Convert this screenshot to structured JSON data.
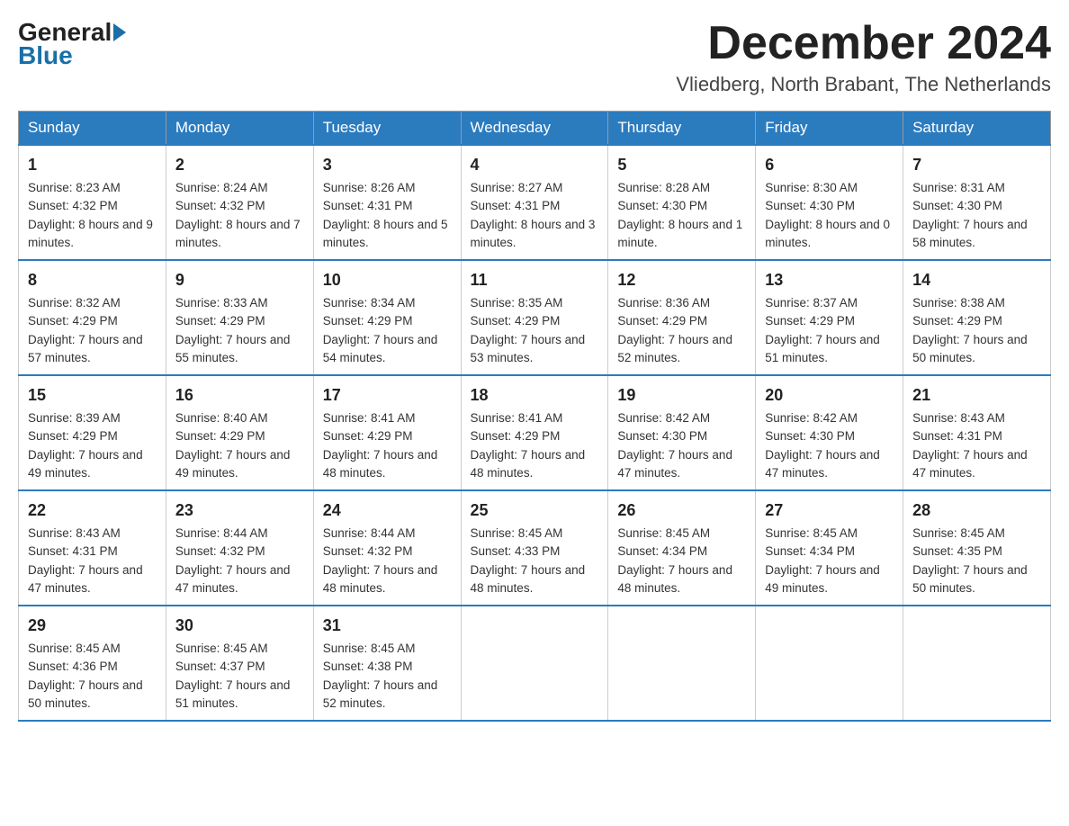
{
  "header": {
    "logo": {
      "text1": "General",
      "text2": "Blue"
    },
    "title": "December 2024",
    "location": "Vliedberg, North Brabant, The Netherlands"
  },
  "days_of_week": [
    "Sunday",
    "Monday",
    "Tuesday",
    "Wednesday",
    "Thursday",
    "Friday",
    "Saturday"
  ],
  "weeks": [
    [
      {
        "day": "1",
        "sunrise": "8:23 AM",
        "sunset": "4:32 PM",
        "daylight": "8 hours and 9 minutes."
      },
      {
        "day": "2",
        "sunrise": "8:24 AM",
        "sunset": "4:32 PM",
        "daylight": "8 hours and 7 minutes."
      },
      {
        "day": "3",
        "sunrise": "8:26 AM",
        "sunset": "4:31 PM",
        "daylight": "8 hours and 5 minutes."
      },
      {
        "day": "4",
        "sunrise": "8:27 AM",
        "sunset": "4:31 PM",
        "daylight": "8 hours and 3 minutes."
      },
      {
        "day": "5",
        "sunrise": "8:28 AM",
        "sunset": "4:30 PM",
        "daylight": "8 hours and 1 minute."
      },
      {
        "day": "6",
        "sunrise": "8:30 AM",
        "sunset": "4:30 PM",
        "daylight": "8 hours and 0 minutes."
      },
      {
        "day": "7",
        "sunrise": "8:31 AM",
        "sunset": "4:30 PM",
        "daylight": "7 hours and 58 minutes."
      }
    ],
    [
      {
        "day": "8",
        "sunrise": "8:32 AM",
        "sunset": "4:29 PM",
        "daylight": "7 hours and 57 minutes."
      },
      {
        "day": "9",
        "sunrise": "8:33 AM",
        "sunset": "4:29 PM",
        "daylight": "7 hours and 55 minutes."
      },
      {
        "day": "10",
        "sunrise": "8:34 AM",
        "sunset": "4:29 PM",
        "daylight": "7 hours and 54 minutes."
      },
      {
        "day": "11",
        "sunrise": "8:35 AM",
        "sunset": "4:29 PM",
        "daylight": "7 hours and 53 minutes."
      },
      {
        "day": "12",
        "sunrise": "8:36 AM",
        "sunset": "4:29 PM",
        "daylight": "7 hours and 52 minutes."
      },
      {
        "day": "13",
        "sunrise": "8:37 AM",
        "sunset": "4:29 PM",
        "daylight": "7 hours and 51 minutes."
      },
      {
        "day": "14",
        "sunrise": "8:38 AM",
        "sunset": "4:29 PM",
        "daylight": "7 hours and 50 minutes."
      }
    ],
    [
      {
        "day": "15",
        "sunrise": "8:39 AM",
        "sunset": "4:29 PM",
        "daylight": "7 hours and 49 minutes."
      },
      {
        "day": "16",
        "sunrise": "8:40 AM",
        "sunset": "4:29 PM",
        "daylight": "7 hours and 49 minutes."
      },
      {
        "day": "17",
        "sunrise": "8:41 AM",
        "sunset": "4:29 PM",
        "daylight": "7 hours and 48 minutes."
      },
      {
        "day": "18",
        "sunrise": "8:41 AM",
        "sunset": "4:29 PM",
        "daylight": "7 hours and 48 minutes."
      },
      {
        "day": "19",
        "sunrise": "8:42 AM",
        "sunset": "4:30 PM",
        "daylight": "7 hours and 47 minutes."
      },
      {
        "day": "20",
        "sunrise": "8:42 AM",
        "sunset": "4:30 PM",
        "daylight": "7 hours and 47 minutes."
      },
      {
        "day": "21",
        "sunrise": "8:43 AM",
        "sunset": "4:31 PM",
        "daylight": "7 hours and 47 minutes."
      }
    ],
    [
      {
        "day": "22",
        "sunrise": "8:43 AM",
        "sunset": "4:31 PM",
        "daylight": "7 hours and 47 minutes."
      },
      {
        "day": "23",
        "sunrise": "8:44 AM",
        "sunset": "4:32 PM",
        "daylight": "7 hours and 47 minutes."
      },
      {
        "day": "24",
        "sunrise": "8:44 AM",
        "sunset": "4:32 PM",
        "daylight": "7 hours and 48 minutes."
      },
      {
        "day": "25",
        "sunrise": "8:45 AM",
        "sunset": "4:33 PM",
        "daylight": "7 hours and 48 minutes."
      },
      {
        "day": "26",
        "sunrise": "8:45 AM",
        "sunset": "4:34 PM",
        "daylight": "7 hours and 48 minutes."
      },
      {
        "day": "27",
        "sunrise": "8:45 AM",
        "sunset": "4:34 PM",
        "daylight": "7 hours and 49 minutes."
      },
      {
        "day": "28",
        "sunrise": "8:45 AM",
        "sunset": "4:35 PM",
        "daylight": "7 hours and 50 minutes."
      }
    ],
    [
      {
        "day": "29",
        "sunrise": "8:45 AM",
        "sunset": "4:36 PM",
        "daylight": "7 hours and 50 minutes."
      },
      {
        "day": "30",
        "sunrise": "8:45 AM",
        "sunset": "4:37 PM",
        "daylight": "7 hours and 51 minutes."
      },
      {
        "day": "31",
        "sunrise": "8:45 AM",
        "sunset": "4:38 PM",
        "daylight": "7 hours and 52 minutes."
      },
      null,
      null,
      null,
      null
    ]
  ]
}
